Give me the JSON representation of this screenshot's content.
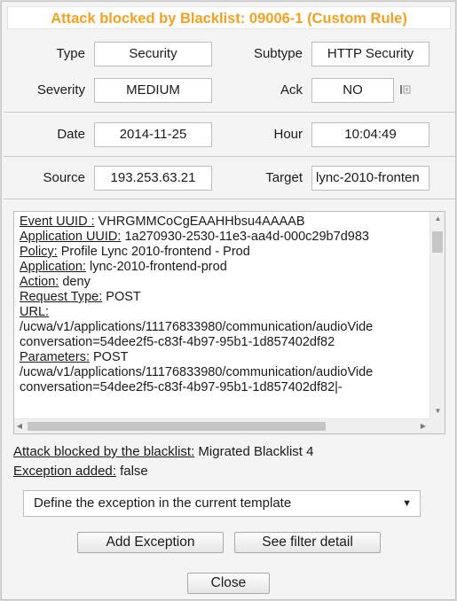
{
  "title": "Attack blocked by Blacklist: 09006-1  (Custom Rule)",
  "fields": {
    "type_label": "Type",
    "type_value": "Security",
    "subtype_label": "Subtype",
    "subtype_value": "HTTP Security",
    "severity_label": "Severity",
    "severity_value": "MEDIUM",
    "ack_label": "Ack",
    "ack_value": "NO",
    "date_label": "Date",
    "date_value": "2014-11-25",
    "hour_label": "Hour",
    "hour_value": "10:04:49",
    "source_label": "Source",
    "source_value": "193.253.63.21",
    "target_label": "Target",
    "target_value": "lync-2010-fronten"
  },
  "details": [
    {
      "label": "Event UUID :",
      "value": " VHRGMMCoCgEAAHHbsu4AAAAB"
    },
    {
      "label": "Application UUID:",
      "value": " 1a270930-2530-11e3-aa4d-000c29b7d983"
    },
    {
      "label": "Policy:",
      "value": " Profile Lync 2010-frontend - Prod"
    },
    {
      "label": "Application:",
      "value": " lync-2010-frontend-prod"
    },
    {
      "label": "Action:",
      "value": " deny"
    },
    {
      "label": "Request Type:",
      "value": " POST"
    },
    {
      "label": "URL:",
      "value": ""
    },
    {
      "label": "",
      "value": "/ucwa/v1/applications/11176833980/communication/audioVide"
    },
    {
      "label": "",
      "value": "conversation=54dee2f5-c83f-4b97-95b1-1d857402df82"
    },
    {
      "label": "Parameters:",
      "value": " POST"
    },
    {
      "label": "",
      "value": "/ucwa/v1/applications/11176833980/communication/audioVide"
    },
    {
      "label": "",
      "value": "conversation=54dee2f5-c83f-4b97-95b1-1d857402df82|-"
    }
  ],
  "blacklist_label": "Attack blocked by the blacklist:",
  "blacklist_value": " Migrated Blacklist 4",
  "exception_label": "Exception added:",
  "exception_value": " false",
  "dropdown_selected": "Define the exception in the current template",
  "buttons": {
    "add_exception": "Add Exception",
    "see_filter": "See filter detail",
    "close": "Close"
  },
  "icons": {
    "ack": "edit-ack-icon",
    "dropdown": "chevron-down-icon",
    "scroll_up": "arrow-up-icon",
    "scroll_down": "arrow-down-icon",
    "scroll_left": "arrow-left-icon",
    "scroll_right": "arrow-right-icon"
  },
  "colors": {
    "title": "#f5a01e",
    "panel_bg": "#f4f4f4",
    "field_bg": "#ffffff"
  }
}
